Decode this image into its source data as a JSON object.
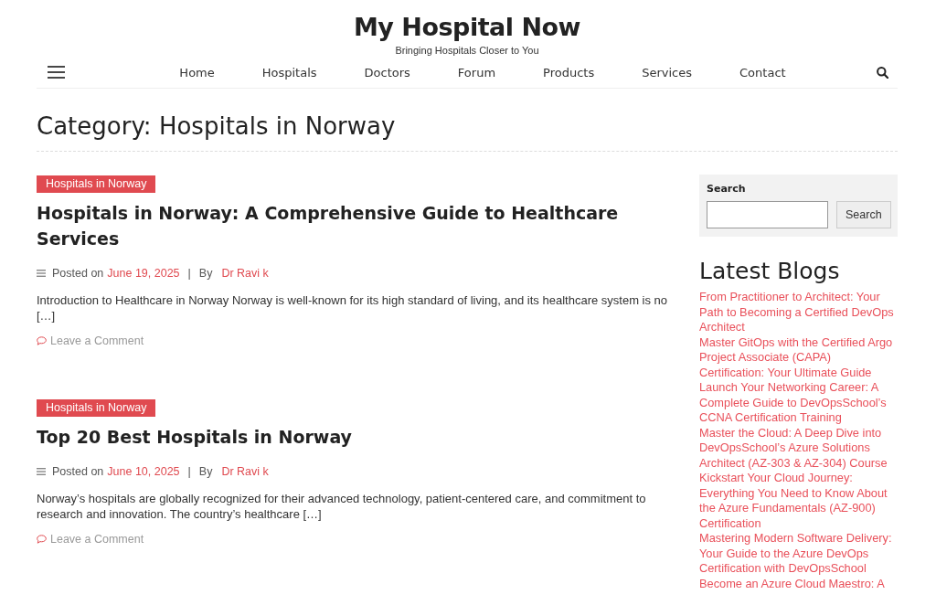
{
  "site": {
    "title": "My Hospital Now",
    "tagline": "Bringing Hospitals Closer to You"
  },
  "nav": {
    "items": [
      "Home",
      "Hospitals",
      "Doctors",
      "Forum",
      "Products",
      "Services",
      "Contact"
    ]
  },
  "page_title": "Category: Hospitals in Norway",
  "posts": [
    {
      "category": "Hospitals in Norway",
      "title": "Hospitals in Norway: A Comprehensive Guide to Healthcare Services",
      "posted_label": "Posted on",
      "date": "June 19, 2025",
      "separator": "|",
      "by_label": "By",
      "author": "Dr Ravi k",
      "excerpt": "Introduction to Healthcare in Norway Norway is well-known for its high standard of living, and its healthcare system is no […]",
      "comment_link": "Leave a Comment"
    },
    {
      "category": "Hospitals in Norway",
      "title": "Top 20 Best Hospitals in Norway",
      "posted_label": "Posted on",
      "date": "June 10, 2025",
      "separator": "|",
      "by_label": "By",
      "author": "Dr Ravi k",
      "excerpt": "Norway’s hospitals are globally recognized for their advanced technology, patient-centered care, and commitment to research and innovation. The country’s healthcare […]",
      "comment_link": "Leave a Comment"
    }
  ],
  "sidebar": {
    "search": {
      "label": "Search",
      "button": "Search"
    },
    "latest_blogs": {
      "heading": "Latest Blogs",
      "links": [
        "From Practitioner to Architect: Your Path to Becoming a Certified DevOps Architect",
        "Master GitOps with the Certified Argo Project Associate (CAPA) Certification: Your Ultimate Guide",
        "Launch Your Networking Career: A Complete Guide to DevOpsSchool’s CCNA Certification Training",
        "Master the Cloud: A Deep Dive into DevOpsSchool’s Azure Solutions Architect (AZ-303 & AZ-304) Course",
        "Kickstart Your Cloud Journey: Everything You Need to Know About the Azure Fundamentals (AZ-900) Certification",
        "Mastering Modern Software Delivery: Your Guide to the Azure DevOps Certification with DevOpsSchool",
        "Become an Azure Cloud Maestro: A"
      ]
    }
  }
}
